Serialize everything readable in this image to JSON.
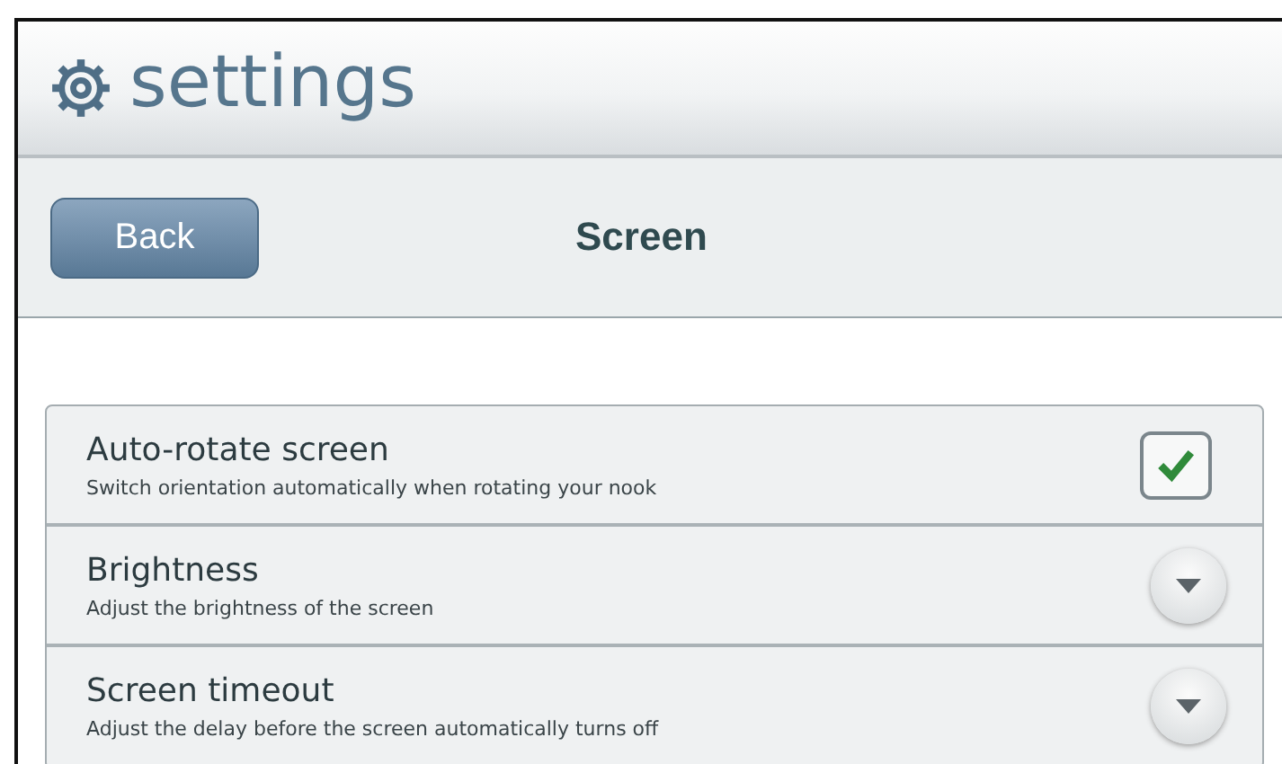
{
  "header": {
    "title": "settings"
  },
  "nav": {
    "back_label": "Back",
    "title": "Screen"
  },
  "settings": [
    {
      "kind": "checkbox",
      "title": "Auto-rotate screen",
      "description": "Switch orientation automatically when rotating your nook",
      "checked": true
    },
    {
      "kind": "dropdown",
      "title": "Brightness",
      "description": "Adjust the brightness of the screen"
    },
    {
      "kind": "dropdown",
      "title": "Screen timeout",
      "description": "Adjust the delay before the screen automatically turns off"
    }
  ]
}
